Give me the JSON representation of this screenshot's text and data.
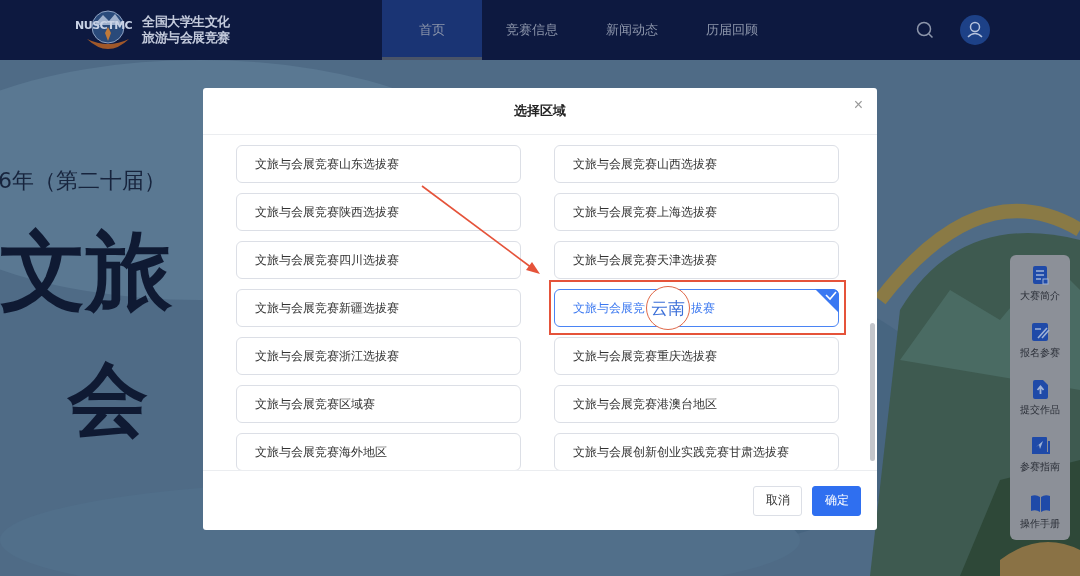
{
  "header": {
    "logo": {
      "acronym": "NUSCTMC",
      "title_line_1": "全国大学生文化",
      "title_line_2": "旅游与会展竞赛"
    },
    "nav": [
      {
        "label": "首页",
        "selected": true
      },
      {
        "label": "竞赛信息",
        "selected": false
      },
      {
        "label": "新闻动态",
        "selected": false
      },
      {
        "label": "历届回顾",
        "selected": false
      }
    ]
  },
  "banner": {
    "edition": "6年（第二十届）",
    "headline_1": "文旅",
    "headline_2": "会"
  },
  "side_menu": [
    "大赛简介",
    "报名参赛",
    "提交作品",
    "参赛指南",
    "操作手册"
  ],
  "dialog": {
    "title": "选择区域",
    "close": "×",
    "options": [
      {
        "kind": "plain",
        "label": "文旅与会展竞赛山东选拔赛",
        "selected": false
      },
      {
        "kind": "plain",
        "label": "文旅与会展竞赛山西选拔赛",
        "selected": false
      },
      {
        "kind": "plain",
        "label": "文旅与会展竞赛陕西选拔赛",
        "selected": false
      },
      {
        "kind": "plain",
        "label": "文旅与会展竞赛上海选拔赛",
        "selected": false
      },
      {
        "kind": "plain",
        "label": "文旅与会展竞赛四川选拔赛",
        "selected": false
      },
      {
        "kind": "plain",
        "label": "文旅与会展竞赛天津选拔赛",
        "selected": false
      },
      {
        "kind": "plain",
        "label": "文旅与会展竞赛新疆选拔赛",
        "selected": false
      },
      {
        "kind": "magnified",
        "before": "文旅与会展竞",
        "zoom": "云南",
        "after": "拔赛",
        "selected": true
      },
      {
        "kind": "plain",
        "label": "文旅与会展竞赛浙江选拔赛",
        "selected": false
      },
      {
        "kind": "plain",
        "label": "文旅与会展竞赛重庆选拔赛",
        "selected": false
      },
      {
        "kind": "plain",
        "label": "文旅与会展竞赛区域赛",
        "selected": false
      },
      {
        "kind": "plain",
        "label": "文旅与会展竞赛港澳台地区",
        "selected": false
      },
      {
        "kind": "plain",
        "label": "文旅与会展竞赛海外地区",
        "selected": false
      },
      {
        "kind": "plain",
        "label": "文旅与会展创新创业实践竞赛甘肃选拔赛",
        "selected": false
      }
    ],
    "buttons": [
      {
        "kind": "cancel",
        "label": "取消"
      },
      {
        "kind": "primary",
        "label": "确定"
      }
    ]
  }
}
